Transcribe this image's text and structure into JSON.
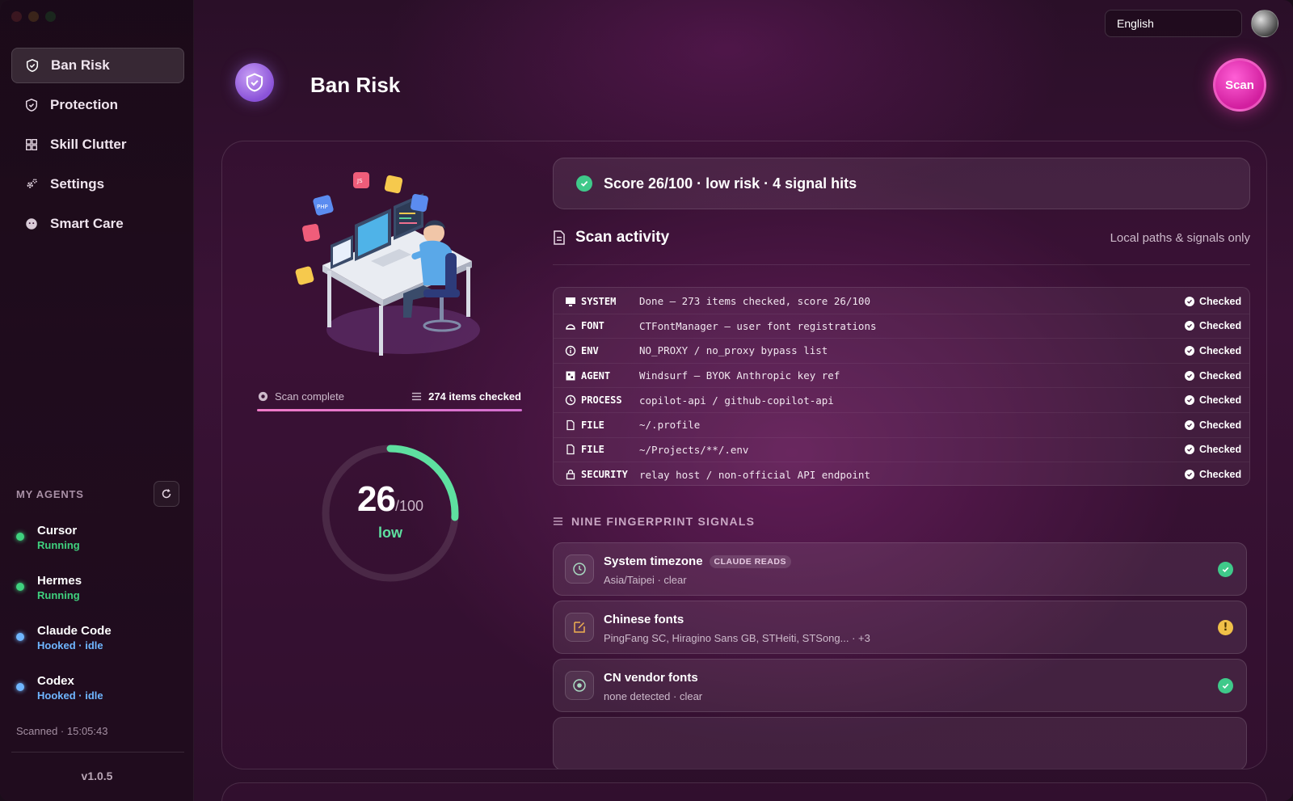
{
  "window": {
    "title": "Ban Risk"
  },
  "sidebar": {
    "nav": [
      {
        "label": "Ban Risk",
        "icon": "shield-icon",
        "active": true
      },
      {
        "label": "Protection",
        "icon": "shield-check-icon",
        "active": false
      },
      {
        "label": "Skill Clutter",
        "icon": "grid-icon",
        "active": false
      },
      {
        "label": "Settings",
        "icon": "gear-icon",
        "active": false
      },
      {
        "label": "Smart Care",
        "icon": "smart-care-icon",
        "active": false
      }
    ],
    "agents_title": "MY AGENTS",
    "agents": [
      {
        "name": "Cursor",
        "status": "Running",
        "color": "#3fd17e"
      },
      {
        "name": "Hermes",
        "status": "Running",
        "color": "#3fd17e"
      },
      {
        "name": "Claude Code",
        "status": "Hooked · idle",
        "color": "#6fb6ff"
      },
      {
        "name": "Codex",
        "status": "Hooked · idle",
        "color": "#6fb6ff"
      }
    ],
    "scanned": "Scanned · 15:05:43",
    "version": "v1.0.5"
  },
  "topbar": {
    "language": "English"
  },
  "header": {
    "title": "Ban Risk",
    "scan_label": "Scan"
  },
  "scan": {
    "status": "Scan complete",
    "items_checked": "274 items checked",
    "score": "26",
    "score_max": "/100",
    "score_fraction": 0.26,
    "level": "low",
    "banner": "Score 26/100 · low risk · 4 signal hits"
  },
  "activity": {
    "title": "Scan activity",
    "note": "Local paths & signals only",
    "rows": [
      {
        "type": "SYSTEM",
        "icon": "monitor-icon",
        "msg": "Done — 273 items checked, score 26/100",
        "status": "Checked"
      },
      {
        "type": "FONT",
        "icon": "font-icon",
        "msg": "CTFontManager — user font registrations",
        "status": "Checked"
      },
      {
        "type": "ENV",
        "icon": "info-icon",
        "msg": "NO_PROXY / no_proxy bypass list",
        "status": "Checked"
      },
      {
        "type": "AGENT",
        "icon": "agent-icon",
        "msg": "Windsurf — BYOK Anthropic key ref",
        "status": "Checked"
      },
      {
        "type": "PROCESS",
        "icon": "clock-icon",
        "msg": "copilot-api / github-copilot-api",
        "status": "Checked"
      },
      {
        "type": "FILE",
        "icon": "file-icon",
        "msg": "~/.profile",
        "status": "Checked"
      },
      {
        "type": "FILE",
        "icon": "file-icon",
        "msg": "~/Projects/**/.env",
        "status": "Checked"
      },
      {
        "type": "SECURITY",
        "icon": "lock-icon",
        "msg": "relay host / non-official API endpoint",
        "status": "Checked"
      }
    ]
  },
  "signals": {
    "title": "NINE FINGERPRINT SIGNALS",
    "items": [
      {
        "title": "System timezone",
        "badge": "CLAUDE READS",
        "sub": "Asia/Taipei · clear",
        "state": "ok",
        "icon": "clock-icon",
        "icon_color": "#a8d8c0"
      },
      {
        "title": "Chinese fonts",
        "badge": "",
        "sub": "PingFang SC, Hiragino Sans GB, STHeiti, STSong... · +3",
        "state": "warn",
        "icon": "edit-icon",
        "icon_color": "#f0b050"
      },
      {
        "title": "CN vendor fonts",
        "badge": "",
        "sub": "none detected · clear",
        "state": "ok",
        "icon": "target-icon",
        "icon_color": "#a8d8c0"
      }
    ]
  },
  "colors": {
    "accent": "#d21f9f",
    "ok": "#3fc98a",
    "warn": "#f0c048",
    "gauge": "#5ee0a0"
  }
}
